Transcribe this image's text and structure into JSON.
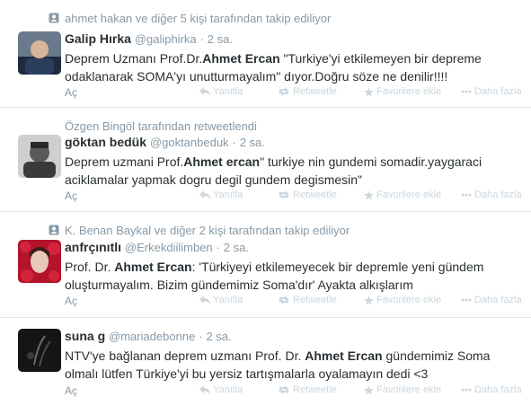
{
  "tweets": [
    {
      "context": "ahmet hakan ve diğer 5 kişi tarafından takip ediliyor",
      "context_icon": "follow-person-icon",
      "name": "Galip Hırka",
      "handle": "@galiphirka",
      "dot": "·",
      "time": "2 sa.",
      "text_parts": [
        "Deprem Uzmanı Prof.Dr.",
        "Ahmet Ercan",
        " \"Turkiye'yi etkilemeyen bir depreme odaklanarak SOMA'yı unutturmayalım\" dıyor.Doğru söze ne denilir!!!!"
      ],
      "open": "Aç"
    },
    {
      "context": "Özgen Bingöl tarafından retweetlendi",
      "context_icon": "",
      "name": "göktan bedük",
      "handle": "@goktanbeduk",
      "dot": "·",
      "time": "2 sa.",
      "text_parts": [
        "Deprem uzmani Prof.",
        "Ahmet ercan",
        "\" turkiye nin gundemi somadir.yaygaraci aciklamalar yapmak dogru degil gundem degismesin\""
      ],
      "open": "Aç"
    },
    {
      "context": "K. Benan Baykal ve diğer 2 kişi tarafından takip ediliyor",
      "context_icon": "follow-person-icon",
      "name": "anfrçınıtlı",
      "handle": "@Erkekdiilimben",
      "dot": "·",
      "time": "2 sa.",
      "text_parts": [
        "Prof. Dr. ",
        "Ahmet Ercan",
        ": 'Türkiyeyi etkilemeyecek bir depremle yeni gündem oluşturmayalım. Bizim gündemimiz Soma'dır' Ayakta alkışlarım"
      ],
      "open": "Aç"
    },
    {
      "context": "",
      "context_icon": "",
      "name": "suna g",
      "handle": "@mariadebonne",
      "dot": "·",
      "time": "2 sa.",
      "text_parts": [
        "NTV'ye bağlanan deprem uzmanı Prof. Dr. ",
        "Ahmet Ercan",
        " gündemimiz Soma olmalı lütfen Türkiye'yi bu yersiz tartışmalarla oyalamayın dedi <3"
      ],
      "open": "Aç"
    }
  ],
  "actions": {
    "reply": "Yanıtla",
    "retweet": "Retweetle",
    "favorite": "Favorilere ekle",
    "more": "Daha fazla"
  },
  "icons": {
    "reply": "reply-icon",
    "retweet": "retweet-icon",
    "favorite": "star-icon",
    "more": "more-dots-icon"
  },
  "colors": {
    "text": "#292f33",
    "muted": "#8899a6",
    "action": "#ccd6dd",
    "divider": "#e1e8ed"
  }
}
